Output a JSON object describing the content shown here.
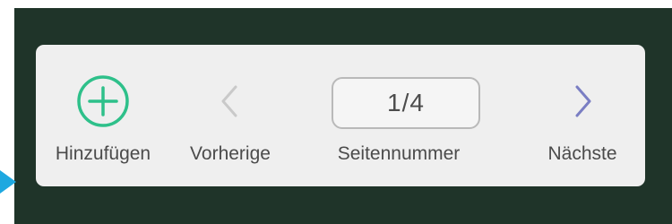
{
  "colors": {
    "board": "#1f3429",
    "toolbar": "#efefef",
    "add_accent": "#2ec08a",
    "nav_disabled": "#c9c9c9",
    "nav_enabled": "#7a7ec3",
    "pointer": "#1ea8e0",
    "label": "#4b4b4b"
  },
  "toolbar": {
    "add": {
      "label": "Hinzufügen",
      "icon": "plus-circle-icon"
    },
    "previous": {
      "label": "Vorherige",
      "icon": "chevron-left-icon",
      "enabled": false
    },
    "page": {
      "label": "Seitennummer",
      "value": "1/4"
    },
    "next": {
      "label": "Nächste",
      "icon": "chevron-right-icon",
      "enabled": true
    }
  }
}
